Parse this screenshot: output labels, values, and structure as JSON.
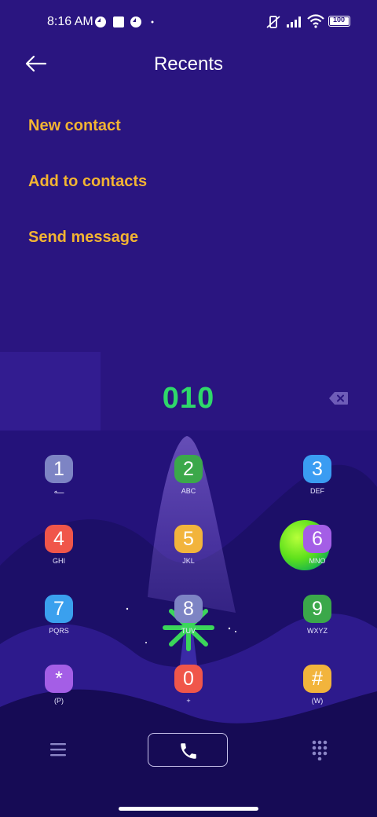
{
  "status_bar": {
    "time": "8:16 AM",
    "battery": "100"
  },
  "header": {
    "title": "Recents"
  },
  "options": [
    {
      "label": "New contact"
    },
    {
      "label": "Add to contacts"
    },
    {
      "label": "Send message"
    }
  ],
  "dialed_number": "010",
  "keypad": [
    {
      "digit": "1",
      "letters": "ـــه",
      "color": "#7d84c4"
    },
    {
      "digit": "2",
      "letters": "ABC",
      "color": "#3ba84a"
    },
    {
      "digit": "3",
      "letters": "DEF",
      "color": "#3a9cf2"
    },
    {
      "digit": "4",
      "letters": "GHI",
      "color": "#f0564a"
    },
    {
      "digit": "5",
      "letters": "JKL",
      "color": "#f2b43c"
    },
    {
      "digit": "6",
      "letters": "MNO",
      "color": "#a45ee6"
    },
    {
      "digit": "7",
      "letters": "PQRS",
      "color": "#3aa0ee"
    },
    {
      "digit": "8",
      "letters": "TUV",
      "color": "#7d84c4"
    },
    {
      "digit": "9",
      "letters": "WXYZ",
      "color": "#3ba84a"
    },
    {
      "digit": "*",
      "letters": "(P)",
      "color": "#a45ee6"
    },
    {
      "digit": "0",
      "letters": "+",
      "color": "#f0564a"
    },
    {
      "digit": "#",
      "letters": "(W)",
      "color": "#f2b43c"
    }
  ],
  "icons": {
    "back": "arrow-left-icon",
    "backspace": "backspace-icon",
    "menu": "menu-icon",
    "call": "phone-icon",
    "dialpad": "dialpad-icon"
  },
  "colors": {
    "accent": "#f3b432",
    "number": "#2fd86a",
    "background": "#2a1580"
  }
}
